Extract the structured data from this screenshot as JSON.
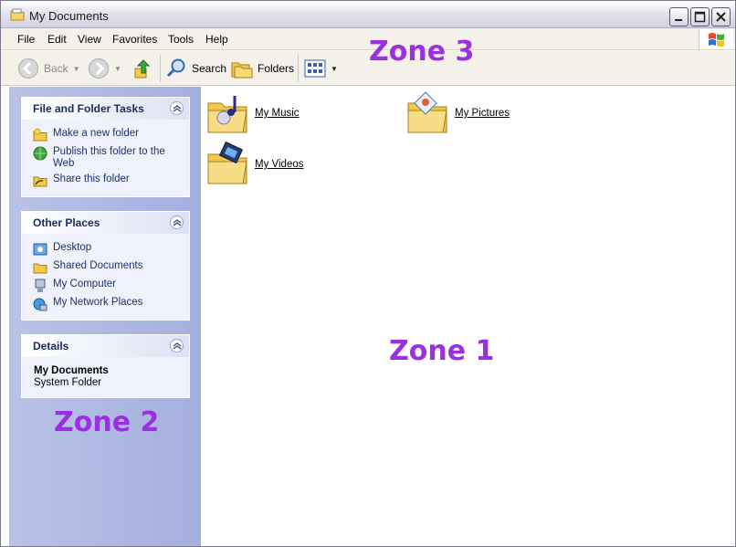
{
  "window": {
    "title": "My Documents"
  },
  "menu": [
    "File",
    "Edit",
    "View",
    "Favorites",
    "Tools",
    "Help"
  ],
  "toolbar": {
    "back": "Back",
    "search": "Search",
    "folders": "Folders"
  },
  "tasks_panel": {
    "title": "File and Folder Tasks",
    "items": [
      "Make a new folder",
      "Publish this folder to the Web",
      "Share this folder"
    ]
  },
  "places_panel": {
    "title": "Other Places",
    "items": [
      "Desktop",
      "Shared Documents",
      "My Computer",
      "My Network Places"
    ]
  },
  "details_panel": {
    "title": "Details",
    "name": "My Documents",
    "type": "System Folder"
  },
  "folders": [
    "My Music",
    "My Pictures",
    "My Videos"
  ],
  "zones": {
    "zone3": "Zone 3",
    "zone1": "Zone 1",
    "zone2": "Zone 2"
  },
  "colors": {
    "zone_label": "#9b30e0",
    "pane_bg": "#a5afdf",
    "link": "#1e2f6e"
  }
}
